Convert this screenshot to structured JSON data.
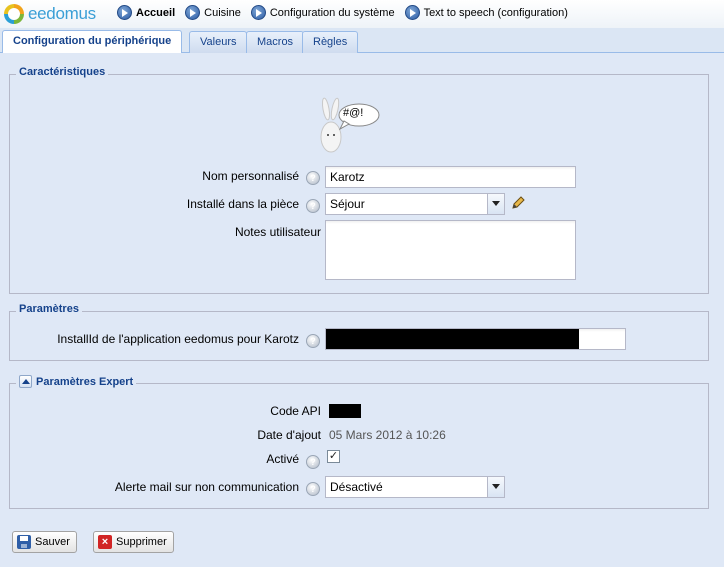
{
  "app": {
    "logo_text": "eedomus"
  },
  "breadcrumb": [
    {
      "label": "Accueil",
      "icon": "arrow-right-icon"
    },
    {
      "label": "Cuisine",
      "icon": "arrow-right-icon"
    },
    {
      "label": "Configuration du système",
      "icon": "arrow-right-icon"
    },
    {
      "label": "Text to speech (configuration)",
      "icon": "arrow-right-icon"
    }
  ],
  "tabs": [
    {
      "label": "Configuration du périphérique",
      "active": true
    },
    {
      "label": "Valeurs",
      "active": false
    },
    {
      "label": "Macros",
      "active": false
    },
    {
      "label": "Règles",
      "active": false
    }
  ],
  "characteristics": {
    "legend": "Caractéristiques",
    "bubble_text": "#@!",
    "name_label": "Nom personnalisé",
    "name_value": "Karotz",
    "room_label": "Installé dans la pièce",
    "room_value": "Séjour",
    "notes_label": "Notes utilisateur",
    "notes_value": ""
  },
  "parameters": {
    "legend": "Paramètres",
    "installid_label": "InstallId de l'application eedomus pour Karotz"
  },
  "expert": {
    "legend": "Paramètres Expert",
    "api_label": "Code API",
    "date_label": "Date d'ajout",
    "date_value": "05 Mars 2012 à 10:26",
    "active_label": "Activé",
    "active_checked": true,
    "alert_label": "Alerte mail sur non communication",
    "alert_value": "Désactivé"
  },
  "actions": {
    "save_label": "Sauver",
    "delete_label": "Supprimer"
  },
  "colors": {
    "header_text": "#15428b",
    "panel_bg": "#dfe8f6",
    "border": "#99bbe8"
  }
}
